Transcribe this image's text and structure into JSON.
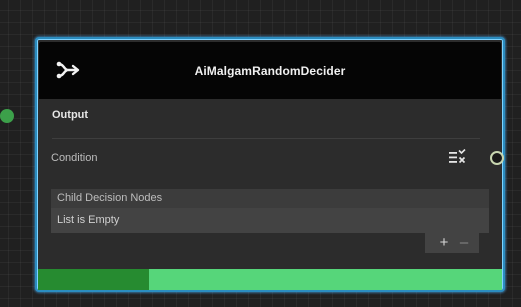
{
  "node": {
    "title": "AiMalgamRandomDecider",
    "icon": "decider-split-arrow-icon"
  },
  "ports": {
    "output_label": "Output",
    "output_color": "#3ca04a"
  },
  "fields": {
    "condition_label": "Condition",
    "condition_icon": "condition-list-check-icon"
  },
  "list": {
    "header": "Child Decision Nodes",
    "empty_text": "List is Empty",
    "add_label": "+",
    "remove_label": "–"
  },
  "progress": {
    "fraction": 0.24,
    "fill_color": "#268b30",
    "track_color": "#56d67a"
  },
  "colors": {
    "selection_border": "#2b8cbf",
    "header_bg": "#050505",
    "body_bg": "#2c2c2c"
  }
}
